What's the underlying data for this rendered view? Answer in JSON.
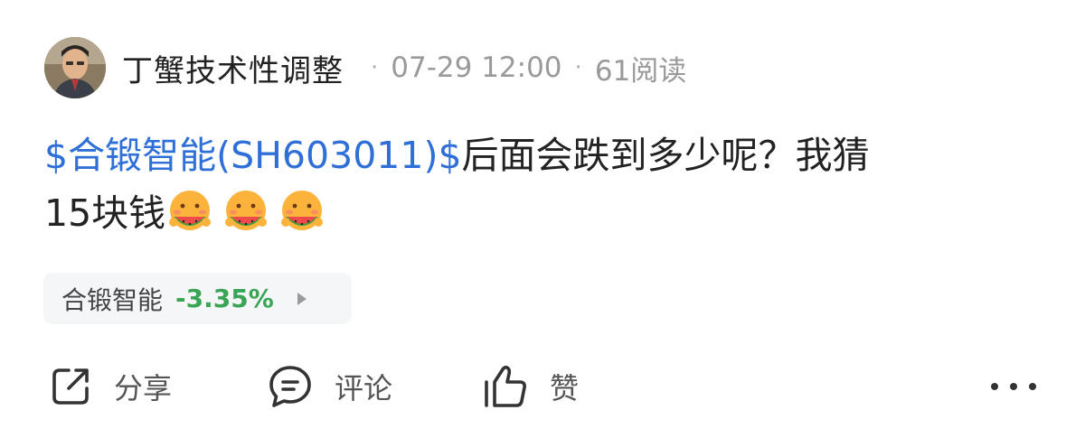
{
  "post": {
    "author": "丁蟹技术性调整",
    "date": "07-29 12:00",
    "separator": "·",
    "reads": "61阅读",
    "stock_tag": "$合锻智能(SH603011)$",
    "text_line1_rest": "后面会跌到多少呢？我猜",
    "text_line2": "15块钱"
  },
  "stock_chip": {
    "name": "合锻智能",
    "change": "-3.35%",
    "change_color": "#3aa655"
  },
  "actions": {
    "share_label": "分享",
    "comment_label": "评论",
    "like_label": "赞"
  },
  "colors": {
    "link": "#2f6fd8",
    "text": "#222222",
    "meta": "#9a9a9a"
  },
  "icons": {
    "share": "share-icon",
    "comment": "comment-icon",
    "like": "thumbs-up-icon",
    "more": "more-icon",
    "emoji": "watermelon-emoji"
  }
}
